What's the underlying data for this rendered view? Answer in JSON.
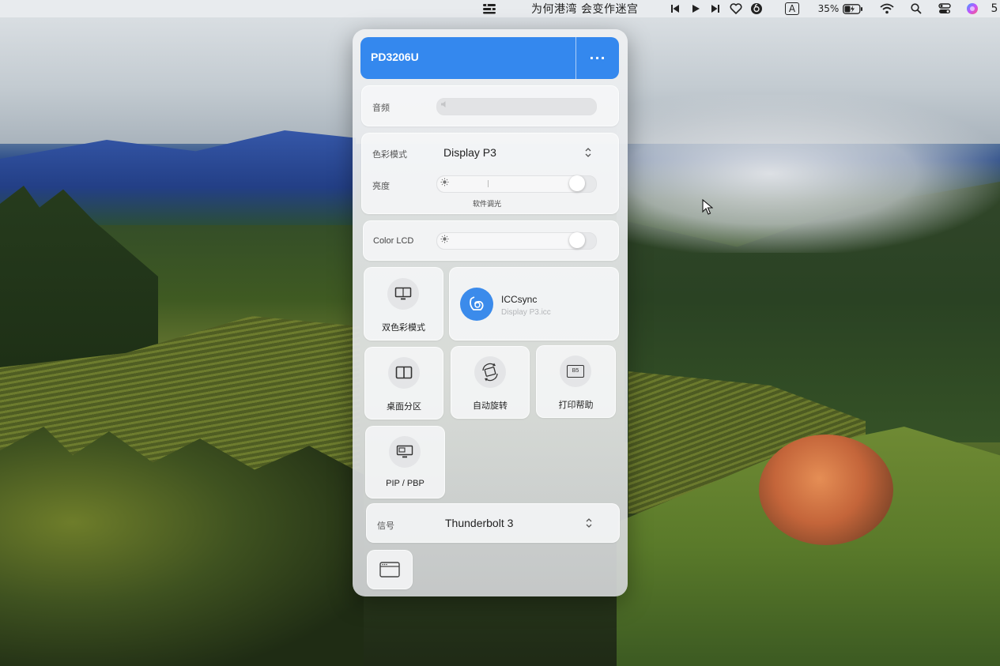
{
  "menubar": {
    "app_icon": "control-strip-icon",
    "now_playing": "为何港湾 会变作迷宫",
    "controls": [
      "previous-track-icon",
      "play-icon",
      "next-track-icon",
      "heart-icon",
      "netease-music-icon"
    ],
    "input_source": "A",
    "battery_percent": "35%",
    "status_icons": [
      "wifi-icon",
      "search-icon",
      "control-center-icon",
      "siri-icon"
    ],
    "clock_partial": "5"
  },
  "panel": {
    "monitor_name": "PD3206U",
    "more_label": "···",
    "audio": {
      "label": "音频"
    },
    "color_mode": {
      "label": "色彩模式",
      "value": "Display P3"
    },
    "brightness": {
      "label": "亮度",
      "caption": "软件调光",
      "level": 0.92
    },
    "color_lcd": {
      "label": "Color LCD",
      "level": 0.92
    },
    "tiles": {
      "dual_color": {
        "label": "双色彩模式",
        "icon": "monitor-icon"
      },
      "iccsync": {
        "title": "ICCsync",
        "subtitle": "Display P3.icc",
        "icon": "iccsync-icon"
      },
      "desktop_split": {
        "label": "桌面分区",
        "icon": "split-screen-icon"
      },
      "auto_rotate": {
        "label": "自动旋转",
        "icon": "rotate-icon"
      },
      "print_help": {
        "label": "打印帮助",
        "icon": "print-b5-icon",
        "badge": "B5"
      },
      "pip_pbp": {
        "label": "PIP / PBP",
        "icon": "pip-icon"
      }
    },
    "signal": {
      "label": "信号",
      "value": "Thunderbolt 3"
    },
    "bottom_button": {
      "icon": "window-icon"
    }
  }
}
